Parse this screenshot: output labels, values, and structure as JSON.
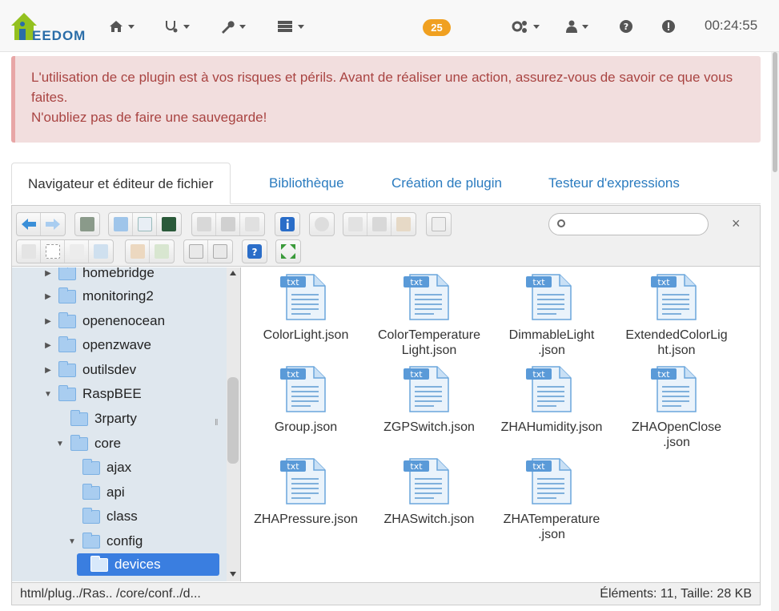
{
  "app": {
    "logo_text": "EEDOM",
    "brand_color": "#2a6da8"
  },
  "topnav": {
    "items": [
      {
        "name": "home",
        "icon": "home-icon"
      },
      {
        "name": "analysis",
        "icon": "stethoscope-icon"
      },
      {
        "name": "tools",
        "icon": "wrench-icon"
      },
      {
        "name": "plugins",
        "icon": "server-icon"
      }
    ],
    "notification_count": "25",
    "right_items": [
      "settings-icon",
      "user-icon",
      "question-icon",
      "exclamation-icon"
    ],
    "clock": "00:24:55"
  },
  "alert": {
    "line1": "L'utilisation de ce plugin est à vos risques et périls. Avant de réaliser une action, assurez-vous de savoir ce que vous faites.",
    "line2": "N'oubliez pas de faire une sauvegarde!",
    "bg_color": "#f2dede",
    "text_color": "#a94442"
  },
  "tabs": [
    {
      "label": "Navigateur et éditeur de fichier",
      "active": true
    },
    {
      "label": "Bibliothèque",
      "active": false
    },
    {
      "label": "Création de plugin",
      "active": false
    },
    {
      "label": "Testeur d'expressions",
      "active": false
    }
  ],
  "search": {
    "placeholder": "",
    "value": ""
  },
  "tree": [
    {
      "label": "homebridge",
      "arrow": "▶"
    },
    {
      "label": "monitoring2",
      "arrow": "▶"
    },
    {
      "label": "openenocean",
      "arrow": "▶"
    },
    {
      "label": "openzwave",
      "arrow": "▶"
    },
    {
      "label": "outilsdev",
      "arrow": "▶"
    },
    {
      "label": "RaspBEE",
      "arrow": "▼"
    },
    {
      "label": "3rparty",
      "arrow": ""
    },
    {
      "label": "core",
      "arrow": "▼"
    },
    {
      "label": "ajax",
      "arrow": ""
    },
    {
      "label": "api",
      "arrow": ""
    },
    {
      "label": "class",
      "arrow": ""
    },
    {
      "label": "config",
      "arrow": "▼"
    },
    {
      "label": "devices",
      "arrow": "",
      "selected": true
    }
  ],
  "files": [
    {
      "line1": "ColorLight.json",
      "line2": ""
    },
    {
      "line1": "ColorTemperature",
      "line2": "Light.json"
    },
    {
      "line1": "DimmableLight",
      "line2": ".json"
    },
    {
      "line1": "ExtendedColorLig",
      "line2": "ht.json"
    },
    {
      "line1": "Group.json",
      "line2": ""
    },
    {
      "line1": "ZGPSwitch.json",
      "line2": ""
    },
    {
      "line1": "ZHAHumidity.json",
      "line2": ""
    },
    {
      "line1": "ZHAOpenClose",
      "line2": ".json"
    },
    {
      "line1": "ZHAPressure.json",
      "line2": ""
    },
    {
      "line1": "ZHASwitch.json",
      "line2": ""
    },
    {
      "line1": "ZHATemperature",
      "line2": ".json"
    }
  ],
  "file_icon_label": "txt",
  "statusbar": {
    "path": "html/plug../Ras.. /core/conf../d...",
    "info": "Éléments: 11, Taille: 28 KB"
  }
}
